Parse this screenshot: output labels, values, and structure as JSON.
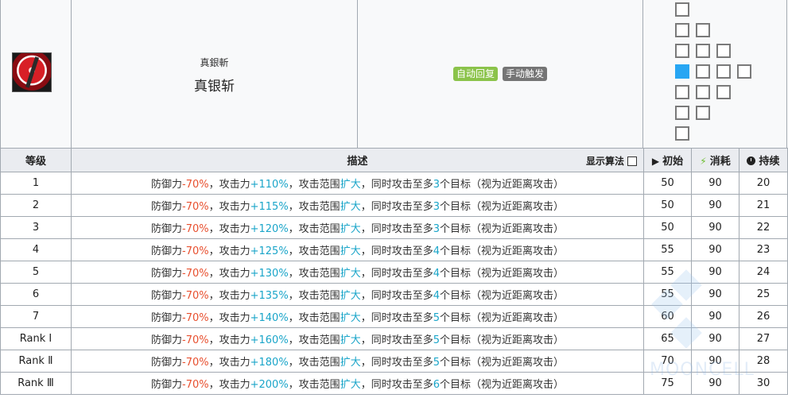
{
  "skill": {
    "name_small": "真銀斬",
    "name_big": "真银斩",
    "icon": "silver-slash-icon",
    "tags": [
      "自动回复",
      "手动触发"
    ],
    "tag_colors": [
      "#8bc34a",
      "#757575"
    ]
  },
  "range": {
    "self_color": "#27a6f3",
    "rows": [
      "□",
      "□□",
      "□□□",
      "■□□□",
      "□□□",
      "□□",
      "□"
    ]
  },
  "table": {
    "headers": {
      "level": "等级",
      "description": "描述",
      "toggle_label": "显示算法",
      "initial": "初始",
      "cost": "消耗",
      "duration": "持续"
    },
    "rows": [
      {
        "level": "1",
        "atk": "+110%",
        "targets": "3",
        "initial": "50",
        "cost": "90",
        "duration": "20"
      },
      {
        "level": "2",
        "atk": "+115%",
        "targets": "3",
        "initial": "50",
        "cost": "90",
        "duration": "21"
      },
      {
        "level": "3",
        "atk": "+120%",
        "targets": "3",
        "initial": "50",
        "cost": "90",
        "duration": "22"
      },
      {
        "level": "4",
        "atk": "+125%",
        "targets": "4",
        "initial": "55",
        "cost": "90",
        "duration": "23"
      },
      {
        "level": "5",
        "atk": "+130%",
        "targets": "4",
        "initial": "55",
        "cost": "90",
        "duration": "24"
      },
      {
        "level": "6",
        "atk": "+135%",
        "targets": "4",
        "initial": "55",
        "cost": "90",
        "duration": "25"
      },
      {
        "level": "7",
        "atk": "+140%",
        "targets": "5",
        "initial": "60",
        "cost": "90",
        "duration": "26"
      },
      {
        "level": "Rank Ⅰ",
        "atk": "+160%",
        "targets": "5",
        "initial": "65",
        "cost": "90",
        "duration": "27"
      },
      {
        "level": "Rank Ⅱ",
        "atk": "+180%",
        "targets": "5",
        "initial": "70",
        "cost": "90",
        "duration": "28"
      },
      {
        "level": "Rank Ⅲ",
        "atk": "+200%",
        "targets": "6",
        "initial": "75",
        "cost": "90",
        "duration": "30"
      }
    ],
    "desc_parts": {
      "p1": "防御力",
      "def": "-70%",
      "p2": "，攻击力",
      "p3": "，攻击范围",
      "expand": "扩大",
      "p4": "，同时攻击至多",
      "p5": "个目标（视为近距离攻击）"
    },
    "colors": {
      "negative": "#e8502f",
      "positive": "#1aa5c9"
    }
  },
  "watermark": {
    "text": "MOONCELL"
  }
}
